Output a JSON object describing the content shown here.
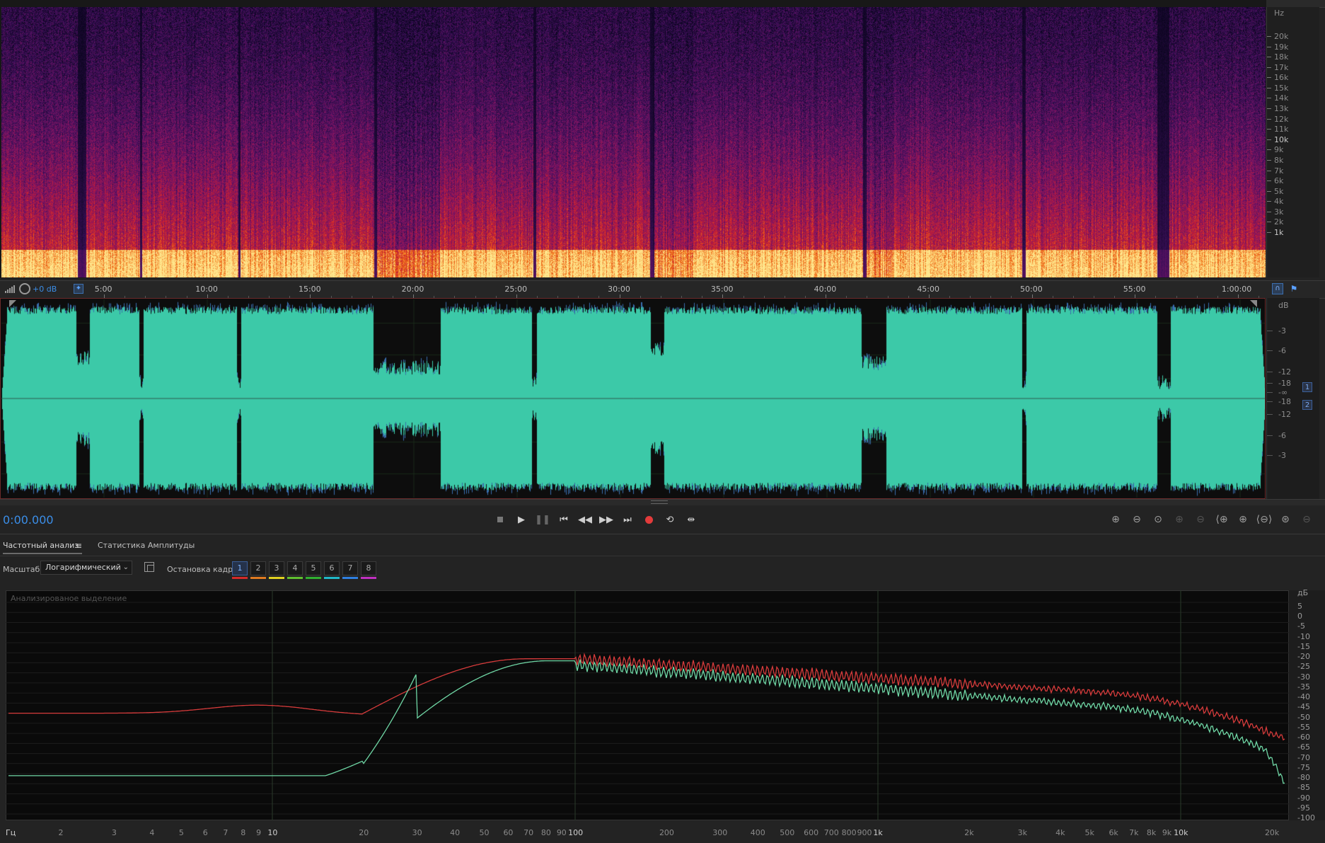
{
  "spectrogram": {
    "hz_unit": "Hz",
    "hz_labels": [
      "20k",
      "19k",
      "18k",
      "17k",
      "16k",
      "15k",
      "14k",
      "13k",
      "12k",
      "11k",
      "10k",
      "9k",
      "8k",
      "7k",
      "6k",
      "5k",
      "4k",
      "3k",
      "2k",
      "1k"
    ]
  },
  "timeline": {
    "db_offset": "+0 dB",
    "labels": [
      "5:00",
      "10:00",
      "15:00",
      "20:00",
      "25:00",
      "30:00",
      "35:00",
      "40:00",
      "45:00",
      "50:00",
      "55:00",
      "1:00:00"
    ]
  },
  "waveform": {
    "db_unit": "dB",
    "db_labels_top": [
      "-3",
      "-6",
      "-12",
      "-18"
    ],
    "db_center": "-∞",
    "db_labels_bottom": [
      "-18",
      "-12",
      "-6",
      "-3"
    ],
    "channels": [
      "1",
      "2"
    ],
    "waveform_color": "#3cc9a8"
  },
  "transport": {
    "current_time": "0:00.000",
    "buttons": [
      "stop",
      "play",
      "pause",
      "go-to-start",
      "rewind",
      "fast-forward",
      "go-to-end",
      "record",
      "loop",
      "skip-selection"
    ],
    "zoom_buttons": [
      "zoom-in-amplitude",
      "zoom-out-amplitude",
      "zoom-reset-amplitude",
      "zoom-in-frequency",
      "zoom-out-frequency",
      "zoom-in-time-left",
      "zoom-in-time",
      "zoom-out-time",
      "zoom-full",
      "zoom-selection"
    ]
  },
  "analysis": {
    "tabs": [
      {
        "label": "Частотный анализ",
        "active": true
      },
      {
        "label": "Статистика Амплитуды",
        "active": false
      }
    ],
    "scale_label": "Масштаб:",
    "scale_value": "Логарифмический",
    "freeze_label": "Остановка кадра:",
    "freeze_slots": [
      "1",
      "2",
      "3",
      "4",
      "5",
      "6",
      "7",
      "8"
    ],
    "freeze_colors": [
      "#d32a2a",
      "#e07a20",
      "#e0d020",
      "#60c030",
      "#30b030",
      "#20b8c8",
      "#2f7fe0",
      "#c030c0"
    ],
    "graph_title": "Анализированое выделение",
    "freq_labels": [
      {
        "text": "Гц",
        "major": true
      },
      {
        "text": "2",
        "major": false
      },
      {
        "text": "3",
        "major": false
      },
      {
        "text": "4",
        "major": false
      },
      {
        "text": "5",
        "major": false
      },
      {
        "text": "6",
        "major": false
      },
      {
        "text": "7",
        "major": false
      },
      {
        "text": "8",
        "major": false
      },
      {
        "text": "9",
        "major": false
      },
      {
        "text": "10",
        "major": true
      },
      {
        "text": "20",
        "major": false
      },
      {
        "text": "30",
        "major": false
      },
      {
        "text": "40",
        "major": false
      },
      {
        "text": "50",
        "major": false
      },
      {
        "text": "60",
        "major": false
      },
      {
        "text": "70",
        "major": false
      },
      {
        "text": "80",
        "major": false
      },
      {
        "text": "90",
        "major": false
      },
      {
        "text": "100",
        "major": true
      },
      {
        "text": "200",
        "major": false
      },
      {
        "text": "300",
        "major": false
      },
      {
        "text": "400",
        "major": false
      },
      {
        "text": "500",
        "major": false
      },
      {
        "text": "600",
        "major": false
      },
      {
        "text": "700",
        "major": false
      },
      {
        "text": "800",
        "major": false
      },
      {
        "text": "900",
        "major": false
      },
      {
        "text": "1k",
        "major": true
      },
      {
        "text": "2k",
        "major": false
      },
      {
        "text": "3k",
        "major": false
      },
      {
        "text": "4k",
        "major": false
      },
      {
        "text": "5k",
        "major": false
      },
      {
        "text": "6k",
        "major": false
      },
      {
        "text": "7k",
        "major": false
      },
      {
        "text": "8k",
        "major": false
      },
      {
        "text": "9k",
        "major": false
      },
      {
        "text": "10k",
        "major": true
      },
      {
        "text": "20k",
        "major": false
      }
    ],
    "db_unit": "дБ",
    "db_labels": [
      "5",
      "0",
      "-5",
      "-10",
      "-15",
      "-20",
      "-25",
      "-30",
      "-35",
      "-40",
      "-45",
      "-50",
      "-55",
      "-60",
      "-65",
      "-70",
      "-75",
      "-80",
      "-85",
      "-90",
      "-95",
      "-100"
    ],
    "series_colors": {
      "channel1": "#d63b3b",
      "channel2": "#6fd7a5"
    }
  }
}
